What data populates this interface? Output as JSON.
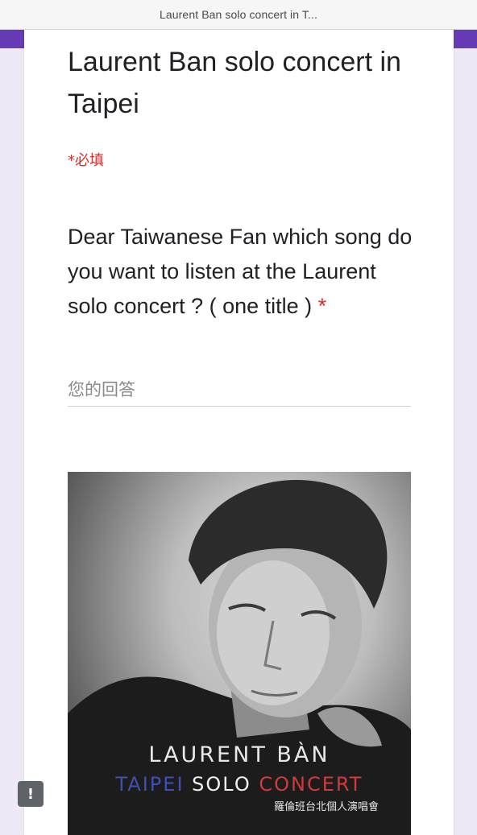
{
  "browser": {
    "title": "Laurent Ban solo concert in T..."
  },
  "form": {
    "title": "Laurent Ban solo concert in Taipei",
    "required_note": "*必填",
    "question": {
      "text": "Dear Taiwanese Fan which song do you want to listen at the Laurent solo concert ? ( one title )",
      "required_marker": "*",
      "answer_placeholder": "您的回答",
      "answer_value": ""
    }
  },
  "poster": {
    "name": "LAURENT BÀN",
    "subtitle_word1": "TAIPEI",
    "subtitle_word2": "SOLO",
    "subtitle_word3": "CONCERT",
    "chinese_title": "羅倫班台北個人演唱會"
  },
  "report_button": {
    "icon": "exclamation-icon",
    "glyph": "!"
  },
  "colors": {
    "accent_purple": "#673ab7",
    "required_red": "#d93025",
    "background": "#efe9f7"
  }
}
